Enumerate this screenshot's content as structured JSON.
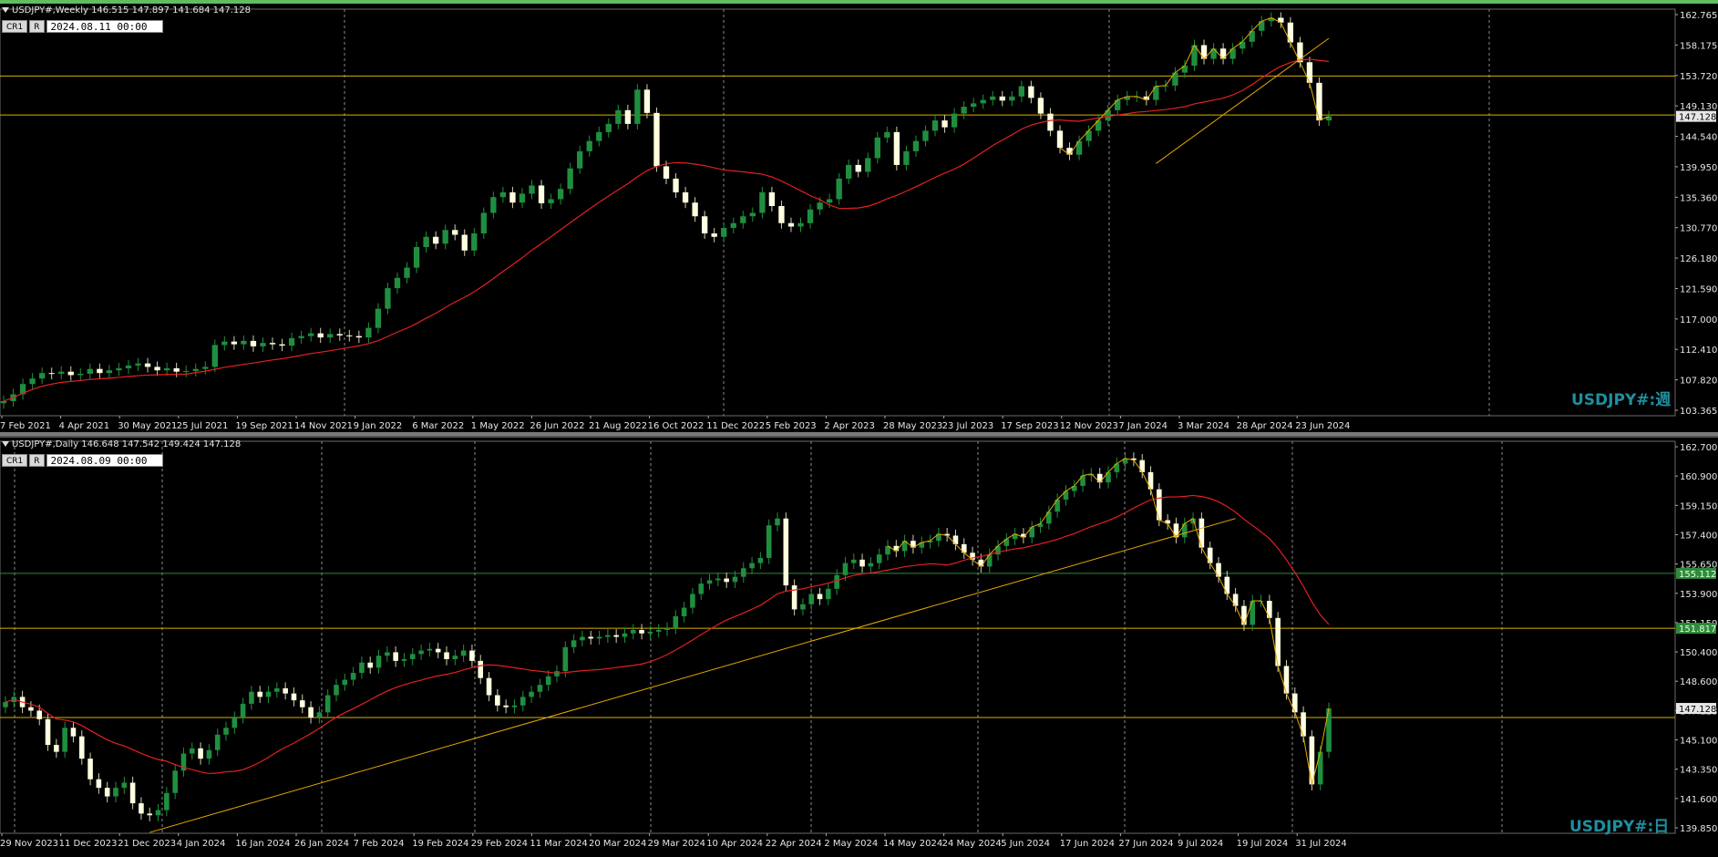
{
  "weekly": {
    "header": "USDJPY#,Weekly  146.515 147.897 141.684 147.128",
    "ctrl_a": "CR1",
    "ctrl_b": "R",
    "date_input": "2024.08.11 00:00",
    "watermark": "USDJPY#:週",
    "price_label": "147.128",
    "hlines": [
      153.0,
      147.3
    ],
    "colors": {
      "up": "#1f8f3f",
      "down": "#ffffe0",
      "ma": "#e32020",
      "trend": "#e6a800",
      "hline": "#d8b000",
      "grid": "#8a8a8a"
    }
  },
  "daily": {
    "header": "USDJPY#,Daily  146.648 147.542 149.424 147.128",
    "ctrl_a": "CR1",
    "ctrl_b": "R",
    "date_input": "2024.08.09 00:00",
    "watermark": "USDJPY#:日",
    "price_label": "147.128",
    "hlines": [
      151.8,
      146.6
    ],
    "green_line": 155.0,
    "tag_1": "155.112",
    "tag_2": "151.817",
    "colors": {
      "up": "#1f8f3f",
      "down": "#ffffe0",
      "ma": "#e32020",
      "trend": "#e6a800",
      "hline": "#d8b000",
      "green": "#2e8b3a",
      "grid": "#8a8a8a"
    }
  },
  "chart_data": [
    {
      "type": "candlestick",
      "title": "USDJPY#,Weekly",
      "ylim": [
        103.365,
        162.765
      ],
      "y_ticks": [
        "162.765",
        "158.175",
        "153.720",
        "149.130",
        "144.540",
        "139.950",
        "135.360",
        "130.770",
        "126.180",
        "121.590",
        "117.000",
        "112.410",
        "107.820",
        "103.365"
      ],
      "x_ticks": [
        "7 Feb 2021",
        "4 Apr 2021",
        "30 May 2021",
        "25 Jul 2021",
        "19 Sep 2021",
        "14 Nov 2021",
        "9 Jan 2022",
        "6 Mar 2022",
        "1 May 2022",
        "26 Jun 2022",
        "21 Aug 2022",
        "16 Oct 2022",
        "11 Dec 2022",
        "5 Feb 2023",
        "2 Apr 2023",
        "28 May 2023",
        "23 Jul 2023",
        "17 Sep 2023",
        "12 Nov 2023",
        "7 Jan 2024",
        "3 Mar 2024",
        "28 Apr 2024",
        "23 Jun 2024"
      ],
      "close_series": [
        105.5,
        106.5,
        108.0,
        108.8,
        109.6,
        109.5,
        109.8,
        109.3,
        109.5,
        110.2,
        109.6,
        110.0,
        110.3,
        110.7,
        111.0,
        110.5,
        110.0,
        110.3,
        109.8,
        109.9,
        110.2,
        110.5,
        113.7,
        114.2,
        113.8,
        114.3,
        113.5,
        114.0,
        113.8,
        113.6,
        114.7,
        115.0,
        115.4,
        114.8,
        115.3,
        115.1,
        115.0,
        114.8,
        116.2,
        119.0,
        122.0,
        123.5,
        125.0,
        128.0,
        129.5,
        128.5,
        130.5,
        129.8,
        127.5,
        130.0,
        133.0,
        135.3,
        136.0,
        134.5,
        135.8,
        137.0,
        134.4,
        135.0,
        136.5,
        139.5,
        142.0,
        143.5,
        144.8,
        146.0,
        148.0,
        146.0,
        151.0,
        147.6,
        139.8,
        138.0,
        136.0,
        134.5,
        132.5,
        130.0,
        129.5,
        130.8,
        131.5,
        132.5,
        133.0,
        136.0,
        134.0,
        131.5,
        131.0,
        131.5,
        133.5,
        134.5,
        135.0,
        138.0,
        140.0,
        139.0,
        141.0,
        144.0,
        144.8,
        140.0,
        142.0,
        143.5,
        145.0,
        146.5,
        145.5,
        147.5,
        148.5,
        149.0,
        149.5,
        150.0,
        149.4,
        150.0,
        151.5,
        149.8,
        147.5,
        145.0,
        142.5,
        141.5,
        143.5,
        145.0,
        146.5,
        148.0,
        149.5,
        150.0,
        150.0,
        149.5,
        151.5,
        151.6,
        153.5,
        154.5,
        157.5,
        155.5,
        157.0,
        155.5,
        157.0,
        158.0,
        159.6,
        161.0,
        161.5,
        160.8,
        157.9,
        155.0,
        152.0,
        146.5,
        147.1
      ]
    },
    {
      "type": "candlestick",
      "title": "USDJPY#,Daily",
      "ylim": [
        139.85,
        162.7
      ],
      "y_ticks": [
        "162.700",
        "160.900",
        "159.150",
        "157.400",
        "155.650",
        "153.900",
        "152.150",
        "150.400",
        "148.600",
        "147.128",
        "145.100",
        "143.350",
        "141.600",
        "139.850"
      ],
      "x_ticks": [
        "29 Nov 2023",
        "11 Dec 2023",
        "21 Dec 2023",
        "4 Jan 2024",
        "16 Jan 2024",
        "26 Jan 2024",
        "7 Feb 2024",
        "19 Feb 2024",
        "29 Feb 2024",
        "11 Mar 2024",
        "20 Mar 2024",
        "29 Mar 2024",
        "10 Apr 2024",
        "22 Apr 2024",
        "2 May 2024",
        "14 May 2024",
        "24 May 2024",
        "5 Jun 2024",
        "17 Jun 2024",
        "27 Jun 2024",
        "9 Jul 2024",
        "19 Jul 2024",
        "31 Jul 2024"
      ],
      "close_series": [
        147.5,
        147.8,
        147.2,
        147.0,
        146.5,
        145.0,
        144.6,
        146.0,
        145.5,
        144.2,
        143.0,
        142.5,
        142.0,
        142.5,
        142.8,
        141.6,
        141.0,
        140.9,
        141.2,
        142.2,
        143.5,
        144.5,
        144.8,
        144.2,
        144.7,
        145.6,
        146.0,
        146.6,
        147.4,
        148.1,
        147.8,
        148.1,
        148.3,
        148.0,
        147.6,
        147.2,
        146.6,
        146.9,
        147.9,
        148.5,
        148.8,
        149.2,
        149.8,
        149.5,
        150.2,
        150.4,
        149.9,
        150.0,
        150.3,
        150.5,
        150.6,
        150.4,
        150.0,
        150.2,
        150.5,
        149.9,
        148.9,
        147.9,
        147.3,
        147.2,
        147.3,
        147.8,
        148.1,
        148.5,
        149.0,
        149.3,
        150.7,
        151.1,
        151.3,
        151.2,
        151.3,
        151.4,
        151.3,
        151.5,
        151.7,
        151.5,
        151.6,
        151.7,
        151.8,
        152.5,
        153.0,
        153.8,
        154.4,
        154.6,
        154.7,
        154.5,
        154.8,
        155.3,
        155.6,
        155.9,
        157.8,
        158.2,
        154.3,
        152.9,
        153.2,
        153.8,
        153.5,
        154.1,
        154.9,
        155.6,
        155.8,
        155.4,
        155.6,
        156.1,
        156.6,
        156.3,
        156.9,
        156.5,
        156.8,
        156.9,
        157.3,
        157.2,
        156.7,
        156.2,
        155.8,
        155.4,
        156.1,
        156.6,
        157.0,
        157.3,
        157.1,
        157.7,
        157.9,
        158.6,
        159.3,
        159.8,
        160.1,
        160.7,
        160.8,
        160.3,
        160.9,
        161.4,
        161.7,
        161.6,
        160.9,
        159.9,
        158.1,
        157.9,
        157.1,
        157.9,
        158.2,
        156.5,
        155.6,
        154.8,
        153.8,
        153.1,
        152.0,
        153.4,
        153.4,
        152.4,
        149.6,
        148.0,
        146.9,
        145.5,
        142.7,
        144.6,
        147.128
      ]
    }
  ]
}
